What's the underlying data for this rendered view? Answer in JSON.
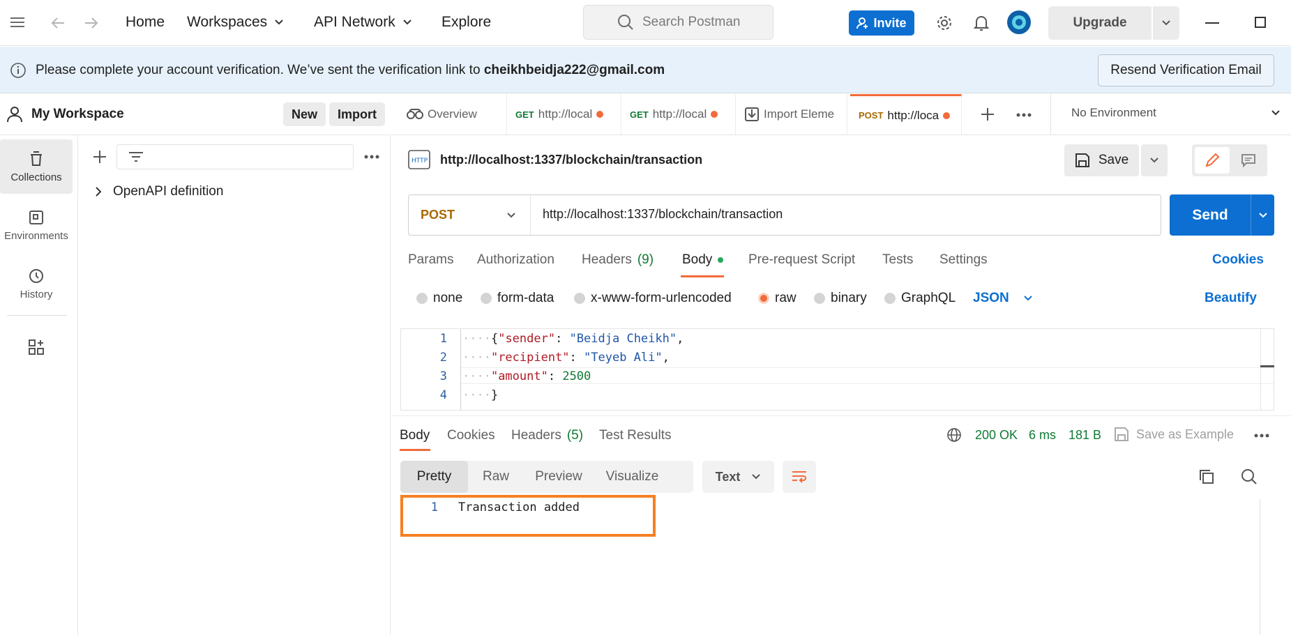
{
  "topbar": {
    "home": "Home",
    "workspaces": "Workspaces",
    "api_network": "API Network",
    "explore": "Explore",
    "search_placeholder": "Search Postman",
    "invite": "Invite",
    "upgrade": "Upgrade"
  },
  "banner": {
    "message": "Please complete your account verification. We’ve sent the verification link to",
    "email": "cheikhbeidja222@gmail.com",
    "resend": "Resend Verification Email"
  },
  "sidebar": {
    "workspace": "My Workspace",
    "new_button": "New",
    "import_button": "Import",
    "rail": [
      {
        "label": "Collections",
        "icon": "collections-icon"
      },
      {
        "label": "Environments",
        "icon": "environments-icon"
      },
      {
        "label": "History",
        "icon": "history-icon"
      }
    ],
    "tree_item": "OpenAPI definition"
  },
  "tabs": [
    {
      "method": "",
      "label": "Overview"
    },
    {
      "method": "GET",
      "label": "http://local"
    },
    {
      "method": "GET",
      "label": "http://local"
    },
    {
      "method": "",
      "label": "Import Eleme"
    },
    {
      "method": "POST",
      "label": "http://loca"
    }
  ],
  "environment": "No Environment",
  "request": {
    "title": "http://localhost:1337/blockchain/transaction",
    "save": "Save",
    "method": "POST",
    "url": "http://localhost:1337/blockchain/transaction",
    "send": "Send",
    "subtabs": {
      "params": "Params",
      "authorization": "Authorization",
      "headers": "Headers",
      "headers_count": "(9)",
      "body": "Body",
      "prerequest": "Pre-request Script",
      "tests": "Tests",
      "settings": "Settings",
      "cookies": "Cookies"
    },
    "body_types": {
      "none": "none",
      "form_data": "form-data",
      "urlencoded": "x-www-form-urlencoded",
      "raw": "raw",
      "binary": "binary",
      "graphql": "GraphQL",
      "format": "JSON",
      "beautify": "Beautify"
    },
    "code_lines": [
      {
        "n": "1",
        "key": "\"sender\"",
        "sep": ": ",
        "val": "\"Beidja Cheikh\"",
        "end": ","
      },
      {
        "n": "2",
        "key": "\"recipient\"",
        "sep": ": ",
        "val": "\"Teyeb Ali\"",
        "end": ","
      },
      {
        "n": "3",
        "key": "\"amount\"",
        "sep": ": ",
        "val": "2500",
        "end": ""
      },
      {
        "n": "4",
        "key": "",
        "sep": "",
        "val": "",
        "end": ""
      }
    ]
  },
  "response": {
    "tabs": {
      "body": "Body",
      "cookies": "Cookies",
      "headers": "Headers",
      "headers_count": "(5)",
      "tests": "Test Results"
    },
    "status": "200 OK",
    "time": "6 ms",
    "size": "181 B",
    "save_example": "Save as Example",
    "views": {
      "pretty": "Pretty",
      "raw": "Raw",
      "preview": "Preview",
      "visualize": "Visualize"
    },
    "format": "Text",
    "line_no": "1",
    "output": "Transaction added"
  }
}
